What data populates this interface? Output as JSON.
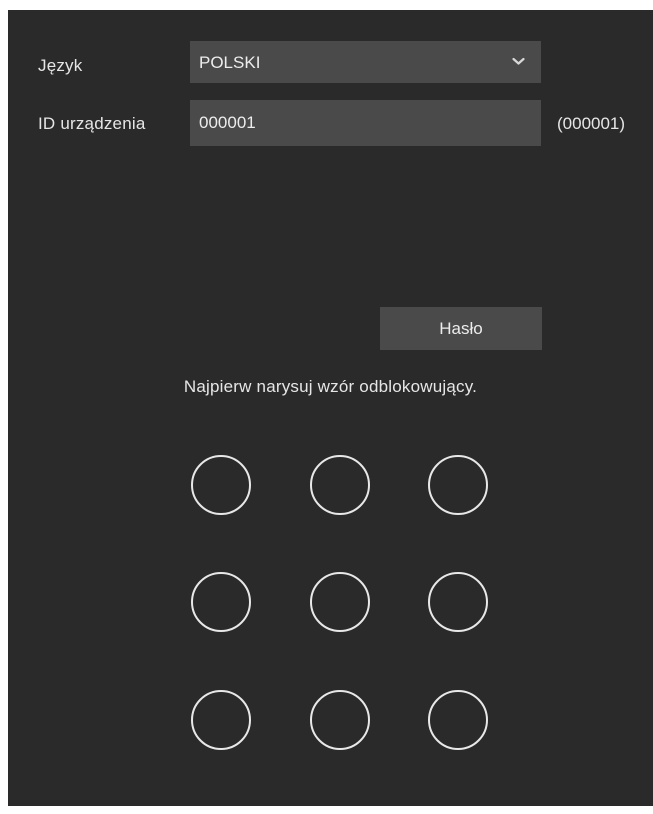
{
  "form": {
    "language_label": "Język",
    "language_value": "POLSKI",
    "device_id_label": "ID urządzenia",
    "device_id_value": "000001",
    "device_id_hint": "(000001)"
  },
  "password_button_label": "Hasło",
  "pattern_instruction": "Najpierw narysuj wzór odblokowujący.",
  "icons": {
    "dropdown": "chevron-down-icon"
  },
  "colors": {
    "background": "#2a2a2a",
    "field": "#4a4a4a",
    "text": "#e6e6e6",
    "pattern_dot": "#e8e8e8"
  }
}
